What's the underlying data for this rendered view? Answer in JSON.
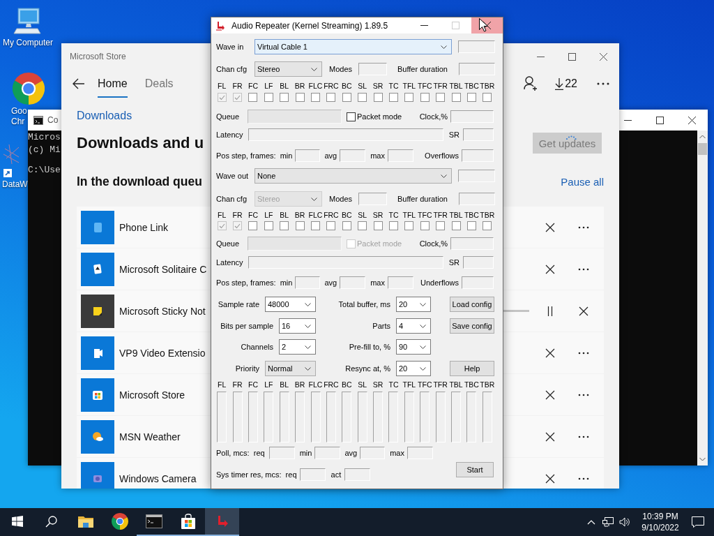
{
  "desktop_icons": [
    {
      "kind": "computer",
      "lines": [
        "My Computer"
      ]
    },
    {
      "kind": "browser",
      "lines": [
        "Goo",
        "Chr"
      ]
    },
    {
      "kind": "network",
      "lines": [
        "DataW"
      ]
    }
  ],
  "console_window": {
    "title": "Co",
    "paragraphs": [
      [
        "Micros",
        "(c) Mi"
      ],
      [
        "C:\\Use"
      ]
    ]
  },
  "store_window": {
    "title": "Microsoft Store",
    "tabs": [
      {
        "label": "Home",
        "selected": true
      },
      {
        "label": "Deals",
        "selected": false
      }
    ],
    "download_count": "22",
    "breadcrumb": "Downloads",
    "heading": "Downloads and u",
    "get_updates": {
      "label": "Get updates",
      "busy": true
    },
    "queue_heading": "In the download queu",
    "pause_all": "Pause all",
    "apps": [
      {
        "name": "Phone Link",
        "kind": "phone",
        "downloading": false
      },
      {
        "name": "Microsoft Solitaire C",
        "kind": "cards",
        "downloading": false
      },
      {
        "name": "Microsoft Sticky Not",
        "kind": "note",
        "downloading": true,
        "level": 0
      },
      {
        "name": "VP9 Video Extensio",
        "kind": "video",
        "downloading": false
      },
      {
        "name": "Microsoft Store",
        "kind": "store",
        "downloading": false
      },
      {
        "name": "MSN Weather",
        "kind": "weather",
        "downloading": false
      },
      {
        "name": "Windows Camera",
        "kind": "camera",
        "downloading": false
      }
    ]
  },
  "audio_repeater": {
    "title": "Audio Repeater (Kernel Streaming) 1.89.5",
    "maximize_disabled": true,
    "close_hovered": true,
    "streams": [
      {
        "label": "Wave in",
        "device": "Virtual Cable 1",
        "device_focused": true,
        "chan_cfg_label": "Chan cfg",
        "chan_cfg": "Stereo",
        "chan_cfg_disabled": false,
        "modes_label": "Modes",
        "buffer_label": "Buffer duration",
        "channels": [
          {
            "name": "FL",
            "checked": true
          },
          {
            "name": "FR",
            "checked": true
          },
          {
            "name": "FC",
            "checked": false
          },
          {
            "name": "LF",
            "checked": false
          },
          {
            "name": "BL",
            "checked": false
          },
          {
            "name": "BR",
            "checked": false
          },
          {
            "name": "FLC",
            "checked": false
          },
          {
            "name": "FRC",
            "checked": false
          },
          {
            "name": "BC",
            "checked": false
          },
          {
            "name": "SL",
            "checked": false
          },
          {
            "name": "SR",
            "checked": false
          },
          {
            "name": "TC",
            "checked": false
          },
          {
            "name": "TFL",
            "checked": false
          },
          {
            "name": "TFC",
            "checked": false
          },
          {
            "name": "TFR",
            "checked": false
          },
          {
            "name": "TBL",
            "checked": false
          },
          {
            "name": "TBC",
            "checked": false
          },
          {
            "name": "TBR",
            "checked": false
          }
        ],
        "queue_label": "Queue",
        "packet_mode": "Packet mode",
        "packet_mode_disabled": false,
        "clock_label": "Clock,%",
        "latency_label": "Latency",
        "sr_label": "SR",
        "pos_label": "Pos step, frames:  min",
        "avg_label": "avg",
        "max_label": "max",
        "xrun_label": "Overflows"
      },
      {
        "label": "Wave out",
        "device": "None",
        "device_focused": false,
        "chan_cfg_label": "Chan cfg",
        "chan_cfg": "Stereo",
        "chan_cfg_disabled": true,
        "modes_label": "Modes",
        "buffer_label": "Buffer duration",
        "channels": [
          {
            "name": "FL",
            "checked": true
          },
          {
            "name": "FR",
            "checked": true
          },
          {
            "name": "FC",
            "checked": false
          },
          {
            "name": "LF",
            "checked": false
          },
          {
            "name": "BL",
            "checked": false
          },
          {
            "name": "BR",
            "checked": false
          },
          {
            "name": "FLC",
            "checked": false
          },
          {
            "name": "FRC",
            "checked": false
          },
          {
            "name": "BC",
            "checked": false
          },
          {
            "name": "SL",
            "checked": false
          },
          {
            "name": "SR",
            "checked": false
          },
          {
            "name": "TC",
            "checked": false
          },
          {
            "name": "TFL",
            "checked": false
          },
          {
            "name": "TFC",
            "checked": false
          },
          {
            "name": "TFR",
            "checked": false
          },
          {
            "name": "TBL",
            "checked": false
          },
          {
            "name": "TBC",
            "checked": false
          },
          {
            "name": "TBR",
            "checked": false
          }
        ],
        "queue_label": "Queue",
        "packet_mode": "Packet mode",
        "packet_mode_disabled": true,
        "clock_label": "Clock,%",
        "latency_label": "Latency",
        "sr_label": "SR",
        "pos_label": "Pos step, frames:  min",
        "avg_label": "avg",
        "max_label": "max",
        "xrun_label": "Underflows"
      }
    ],
    "settings": [
      {
        "label": "Sample rate",
        "value": "48000",
        "kind": "edit",
        "right_label": "Total buffer, ms",
        "right_value": "20",
        "button": "Load config"
      },
      {
        "label": "Bits per sample",
        "value": "16",
        "kind": "edit",
        "right_label": "Parts",
        "right_value": "4",
        "button": "Save config"
      },
      {
        "label": "Channels",
        "value": "2",
        "kind": "edit",
        "right_label": "Pre-fill to, %",
        "right_value": "90"
      },
      {
        "label": "Priority",
        "value": "Normal",
        "kind": "list",
        "right_label": "Resync at, %",
        "right_value": "20",
        "button": "Help"
      }
    ],
    "meters": [
      {
        "name": "FL"
      },
      {
        "name": "FR"
      },
      {
        "name": "FC"
      },
      {
        "name": "LF"
      },
      {
        "name": "BL"
      },
      {
        "name": "BR"
      },
      {
        "name": "FLC"
      },
      {
        "name": "FRC"
      },
      {
        "name": "BC"
      },
      {
        "name": "SL"
      },
      {
        "name": "SR"
      },
      {
        "name": "TC"
      },
      {
        "name": "TFL"
      },
      {
        "name": "TFC"
      },
      {
        "name": "TFR"
      },
      {
        "name": "TBL"
      },
      {
        "name": "TBC"
      },
      {
        "name": "TBR"
      }
    ],
    "poll": {
      "label": "Poll, mcs:  req",
      "min_label": "min",
      "avg_label": "avg",
      "max_label": "max"
    },
    "sys_timer": {
      "label": "Sys timer res, mcs:  req",
      "act_label": "act"
    },
    "start": "Start"
  },
  "taskbar": {
    "items": [
      {
        "kind": "start",
        "running": false,
        "active": false
      },
      {
        "kind": "search",
        "running": false,
        "active": false
      },
      {
        "kind": "explorer",
        "running": false,
        "active": false
      },
      {
        "kind": "browser",
        "running": false,
        "active": false
      },
      {
        "kind": "console",
        "running": true,
        "active": false
      },
      {
        "kind": "store",
        "running": true,
        "active": false
      },
      {
        "kind": "audio",
        "running": true,
        "active": true
      }
    ],
    "time": "10:39 PM",
    "date": "9/10/2022"
  }
}
